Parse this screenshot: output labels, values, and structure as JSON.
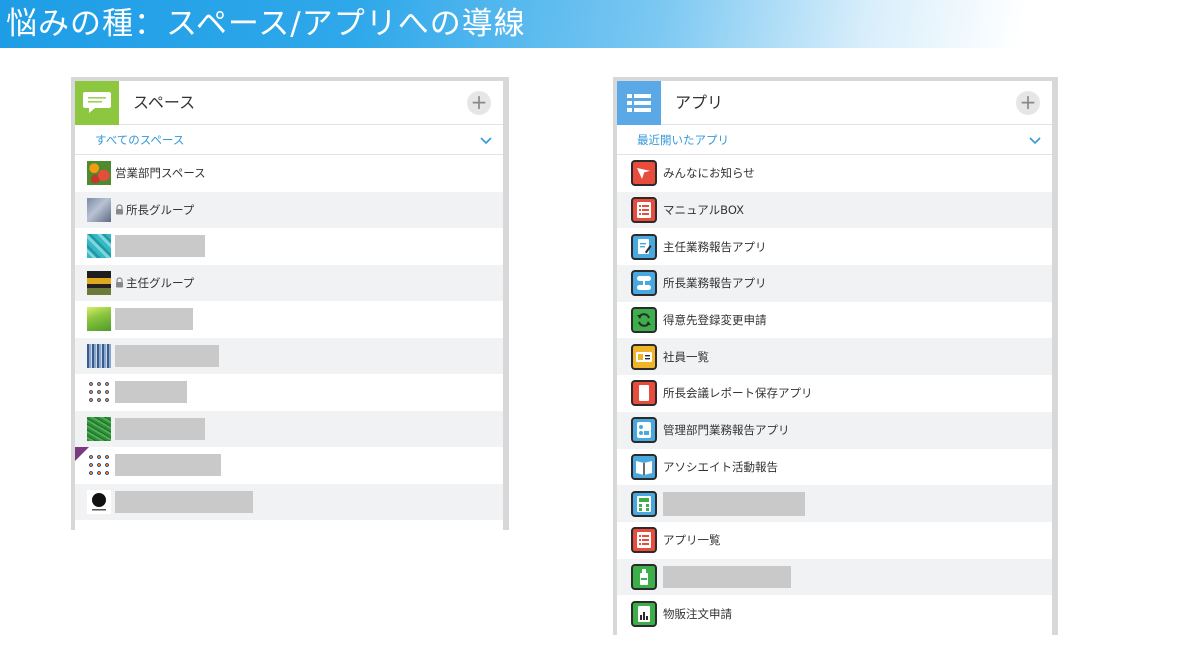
{
  "banner": {
    "title": "悩みの種：スペース/アプリへの導線"
  },
  "spaces_panel": {
    "title": "スペース",
    "add_label": "+",
    "filter_label": "すべてのスペース",
    "items": [
      {
        "label": "営業部門スペース",
        "locked": false,
        "thumb": "red-flowers-image"
      },
      {
        "label": "所長グループ",
        "locked": true,
        "thumb": "blurred-photo-image"
      },
      {
        "label": "",
        "locked": false,
        "thumb": "teal-water-image"
      },
      {
        "label": "主任グループ",
        "locked": true,
        "thumb": "yellow-stripe-image"
      },
      {
        "label": "",
        "locked": false,
        "thumb": "green-leaf-image"
      },
      {
        "label": "",
        "locked": false,
        "thumb": "blue-texture-image"
      },
      {
        "label": "",
        "locked": false,
        "thumb": "tile-pattern-image"
      },
      {
        "label": "",
        "locked": false,
        "thumb": "green-grass-image"
      },
      {
        "label": "",
        "locked": false,
        "thumb": "tile-pattern-image"
      },
      {
        "label": "",
        "locked": false,
        "thumb": "black-logo-image"
      }
    ]
  },
  "apps_panel": {
    "title": "アプリ",
    "add_label": "+",
    "filter_label": "最近開いたアプリ",
    "items": [
      {
        "label": "みんなにお知らせ",
        "icon": "paper-plane-icon",
        "color": "#e74c3c"
      },
      {
        "label": "マニュアルBOX",
        "icon": "list-icon",
        "color": "#e74c3c"
      },
      {
        "label": "主任業務報告アプリ",
        "icon": "document-edit-icon",
        "color": "#4aa8e0"
      },
      {
        "label": "所長業務報告アプリ",
        "icon": "flow-icon",
        "color": "#4aa8e0"
      },
      {
        "label": "得意先登録変更申請",
        "icon": "refresh-icon",
        "color": "#3cae4a"
      },
      {
        "label": "社員一覧",
        "icon": "id-card-icon",
        "color": "#f0b429"
      },
      {
        "label": "所長会議レポート保存アプリ",
        "icon": "document-icon",
        "color": "#e74c3c"
      },
      {
        "label": "管理部門業務報告アプリ",
        "icon": "org-chart-icon",
        "color": "#4aa8e0"
      },
      {
        "label": "アソシエイト活動報告",
        "icon": "book-icon",
        "color": "#4aa8e0"
      },
      {
        "label": "",
        "icon": "calculator-icon",
        "color": "#4aa8e0"
      },
      {
        "label": "アプリ一覧",
        "icon": "list-icon",
        "color": "#e74c3c"
      },
      {
        "label": "",
        "icon": "bottle-icon",
        "color": "#3cae4a"
      },
      {
        "label": "物販注文申請",
        "icon": "chart-doc-icon",
        "color": "#3cae4a"
      }
    ]
  },
  "colors": {
    "accent": "#3498db",
    "header_blue": "#1e9de6",
    "space_green": "#8dc63f",
    "app_blue": "#5aa9e6"
  }
}
